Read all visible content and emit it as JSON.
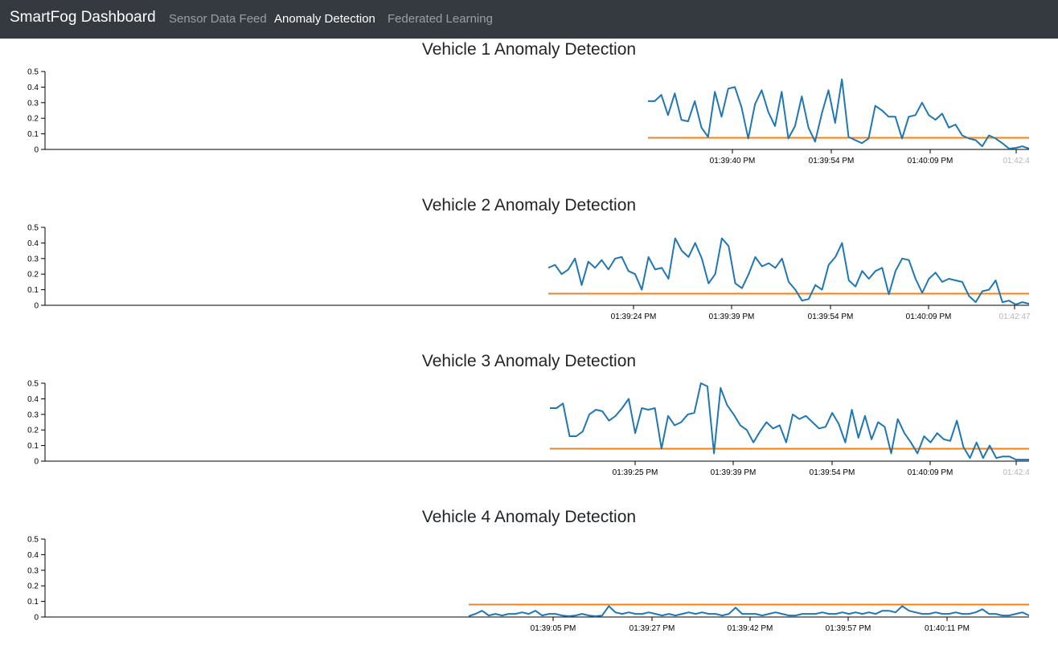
{
  "navbar": {
    "brand": "SmartFog Dashboard",
    "links": [
      {
        "label": "Sensor Data Feed",
        "active": false
      },
      {
        "label": "Anomaly Detection",
        "active": true
      },
      {
        "label": "Federated Learning",
        "active": false
      }
    ],
    "background": "#343a40"
  },
  "colors": {
    "series": "#1f77b4",
    "threshold": "#ff7f0e"
  },
  "chart_data": [
    {
      "type": "line",
      "title": "Vehicle 1 Anomaly Detection",
      "ylim": [
        0,
        0.5
      ],
      "yticks": [
        "0",
        "0.1",
        "0.2",
        "0.3",
        "0.4",
        "0.5"
      ],
      "xticks": [
        "01:39:40 PM",
        "01:39:54 PM",
        "01:40:09 PM",
        "01:42:4"
      ],
      "series": [
        {
          "values": [
            0.31,
            0.31,
            0.35,
            0.22,
            0.36,
            0.19,
            0.18,
            0.31,
            0.14,
            0.08,
            0.37,
            0.21,
            0.39,
            0.4,
            0.27,
            0.07,
            0.29,
            0.38,
            0.24,
            0.15,
            0.37,
            0.07,
            0.15,
            0.34,
            0.14,
            0.05,
            0.23,
            0.38,
            0.17,
            0.45,
            0.08,
            0.06,
            0.04,
            0.07,
            0.28,
            0.25,
            0.21,
            0.21,
            0.07,
            0.21,
            0.22,
            0.3,
            0.22,
            0.19,
            0.23,
            0.14,
            0.16,
            0.09,
            0.07,
            0.06,
            0.02,
            0.09,
            0.07,
            0.04,
            0.005,
            0.01,
            0.02,
            0.005
          ]
        },
        {
          "values": [
            0.075,
            0.075
          ]
        }
      ]
    },
    {
      "type": "line",
      "title": "Vehicle 2 Anomaly Detection",
      "ylim": [
        0,
        0.5
      ],
      "yticks": [
        "0",
        "0.1",
        "0.2",
        "0.3",
        "0.4",
        "0.5"
      ],
      "xticks": [
        "01:39:24 PM",
        "01:39:39 PM",
        "01:39:54 PM",
        "01:40:09 PM",
        "01:42:47"
      ],
      "series": [
        {
          "values": [
            0.24,
            0.26,
            0.2,
            0.23,
            0.3,
            0.13,
            0.28,
            0.24,
            0.29,
            0.23,
            0.3,
            0.31,
            0.22,
            0.2,
            0.1,
            0.31,
            0.23,
            0.24,
            0.17,
            0.43,
            0.35,
            0.31,
            0.4,
            0.3,
            0.14,
            0.2,
            0.43,
            0.38,
            0.14,
            0.11,
            0.2,
            0.31,
            0.25,
            0.27,
            0.24,
            0.3,
            0.15,
            0.1,
            0.03,
            0.04,
            0.13,
            0.1,
            0.26,
            0.31,
            0.4,
            0.16,
            0.12,
            0.22,
            0.17,
            0.22,
            0.24,
            0.07,
            0.22,
            0.3,
            0.29,
            0.17,
            0.08,
            0.17,
            0.21,
            0.15,
            0.17,
            0.16,
            0.15,
            0.06,
            0.02,
            0.09,
            0.1,
            0.16,
            0.02,
            0.03,
            0.005,
            0.02,
            0.01
          ]
        },
        {
          "values": [
            0.075,
            0.075
          ]
        }
      ]
    },
    {
      "type": "line",
      "title": "Vehicle 3 Anomaly Detection",
      "ylim": [
        0,
        0.5
      ],
      "yticks": [
        "0",
        "0.1",
        "0.2",
        "0.3",
        "0.4",
        "0.5"
      ],
      "xticks": [
        "01:39:25 PM",
        "01:39:39 PM",
        "01:39:54 PM",
        "01:40:09 PM",
        "01:42:4"
      ],
      "series": [
        {
          "values": [
            0.34,
            0.34,
            0.37,
            0.16,
            0.16,
            0.19,
            0.3,
            0.33,
            0.32,
            0.26,
            0.29,
            0.34,
            0.4,
            0.18,
            0.34,
            0.33,
            0.34,
            0.08,
            0.29,
            0.23,
            0.25,
            0.3,
            0.31,
            0.5,
            0.48,
            0.05,
            0.47,
            0.36,
            0.3,
            0.23,
            0.2,
            0.12,
            0.19,
            0.25,
            0.21,
            0.23,
            0.12,
            0.3,
            0.27,
            0.29,
            0.25,
            0.21,
            0.22,
            0.31,
            0.24,
            0.12,
            0.33,
            0.15,
            0.29,
            0.14,
            0.25,
            0.22,
            0.05,
            0.27,
            0.18,
            0.12,
            0.05,
            0.16,
            0.12,
            0.18,
            0.14,
            0.13,
            0.26,
            0.09,
            0.02,
            0.12,
            0.02,
            0.1,
            0.02,
            0.03,
            0.03,
            0.01,
            0.01,
            0.01
          ]
        },
        {
          "values": [
            0.08,
            0.08
          ]
        }
      ]
    },
    {
      "type": "line",
      "title": "Vehicle 4 Anomaly Detection",
      "ylim": [
        0,
        0.5
      ],
      "yticks": [
        "0",
        "0.1",
        "0.2",
        "0.3",
        "0.4",
        "0.5"
      ],
      "xticks": [
        "01:39:05 PM",
        "01:39:27 PM",
        "01:39:42 PM",
        "01:39:57 PM",
        "01:40:11 PM"
      ],
      "series": [
        {
          "values": [
            0.005,
            0.02,
            0.04,
            0.01,
            0.02,
            0.01,
            0.02,
            0.02,
            0.03,
            0.02,
            0.04,
            0.01,
            0.02,
            0.02,
            0.01,
            0.005,
            0.01,
            0.02,
            0.01,
            0.005,
            0.01,
            0.07,
            0.03,
            0.02,
            0.03,
            0.02,
            0.02,
            0.03,
            0.02,
            0.01,
            0.02,
            0.01,
            0.02,
            0.03,
            0.02,
            0.03,
            0.02,
            0.02,
            0.01,
            0.02,
            0.06,
            0.02,
            0.02,
            0.02,
            0.01,
            0.02,
            0.03,
            0.02,
            0.01,
            0.01,
            0.02,
            0.02,
            0.02,
            0.03,
            0.02,
            0.02,
            0.03,
            0.02,
            0.03,
            0.02,
            0.03,
            0.02,
            0.04,
            0.04,
            0.03,
            0.07,
            0.04,
            0.03,
            0.02,
            0.02,
            0.03,
            0.02,
            0.02,
            0.03,
            0.02,
            0.02,
            0.03,
            0.05,
            0.02,
            0.02,
            0.01,
            0.01,
            0.02,
            0.03,
            0.01
          ]
        },
        {
          "values": [
            0.08,
            0.08
          ]
        }
      ]
    }
  ]
}
